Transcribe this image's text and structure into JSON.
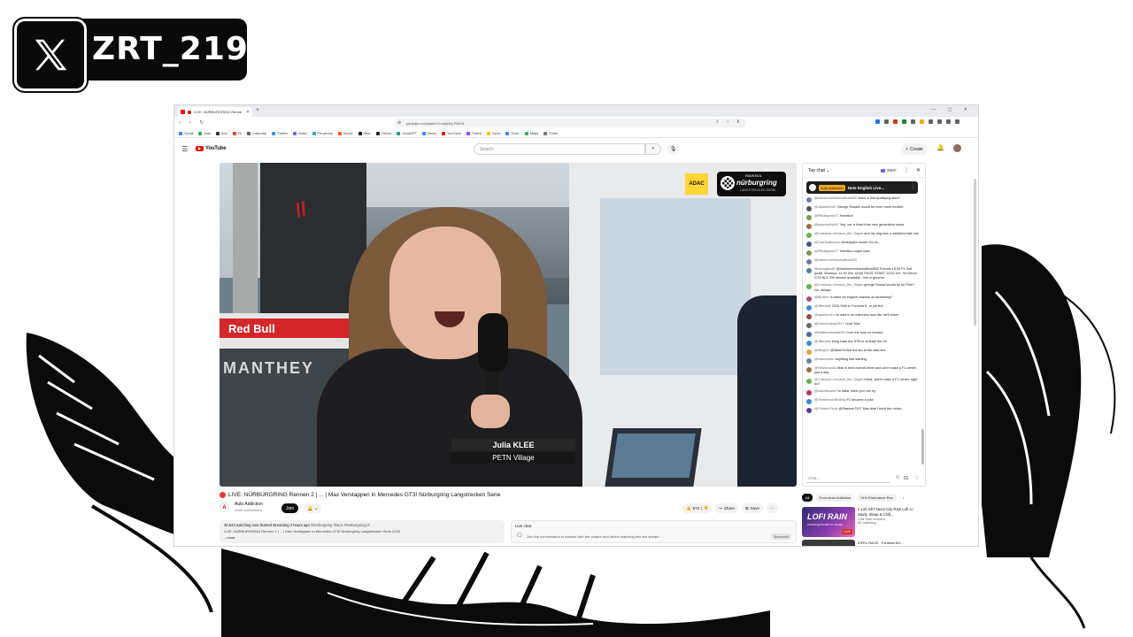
{
  "overlay": {
    "platform_icon": "x-logo-icon",
    "handle": "ZRT_219"
  },
  "browser": {
    "tab_title": "LIVE: NÜRBURGRING Renne",
    "url": "youtube.com/watch?v=mj4Hy-FiNCA",
    "bookmarks": [
      "Gmail",
      "Mail",
      "Ads",
      "Fit",
      "Calendar",
      "Twitter",
      "Anda",
      "Perplexity",
      "Music",
      "Nike",
      "Github",
      "ChatGPT",
      "News",
      "YouTube",
      "Twitch",
      "Drive",
      "Docs",
      "Maps",
      "Other",
      "Crypto",
      "Alle"
    ]
  },
  "youtube": {
    "logo_text": "YouTube",
    "search_placeholder": "Search",
    "create_label": "Create",
    "video": {
      "lower_third_name": "Julia KLEE",
      "lower_third_sub": "PETN Village",
      "adac": "ADAC",
      "nring_top": "RAVENOL",
      "nring_mid": "nürburgring",
      "nring_bot": "LANGSTRECKEN-SERIE"
    },
    "title": "LIVE: NÜRBURGRING Rennen 2 | ... | Max Verstappen in Mercedes GT3! Nürburgring Langstrecken Serie",
    "channel": "Auto Addiction",
    "subscribers": "166K subscribers",
    "join_label": "Join",
    "likes": "572",
    "share_label": "Share",
    "save_label": "Save",
    "desc_stats": "30,543 watching now  Started streaming 2 hours ago",
    "desc_tags": "#Nürburgring #NLS #NurburgringLS",
    "desc_line2": "LIVE: NÜRBURGRING Rennen 2 | ... | Max Verstappen in Mercedes GT3! Nürburgring Langstrecken Serie 2025",
    "desc_more": "...more",
    "livebox_heading": "Live chat",
    "livebox_msg": "Join the conversation to interact with the creator and others watching this live stream",
    "livebox_tag": "Sponsored"
  },
  "chat": {
    "header": "Top chat",
    "viewers": "35KF",
    "pinned_name": "Auto Addiction",
    "pinned_text": "Note English Live...",
    "messages": [
      {
        "author": "@hansrennerbackofficial392",
        "text": "when is first qualifying start?",
        "color": "#6d7fa8"
      },
      {
        "author": "@JackieDriver",
        "text": "George Russell would be even more excited",
        "color": "#555"
      },
      {
        "author": "@Pitfullspeed77",
        "text": "Hamilton",
        "color": "#7a9a5a"
      },
      {
        "author": "@sopersdrive87",
        "text": "Yep, car is fixed from new generation races",
        "color": "#9c6c4a"
      },
      {
        "author": "@Crashout-Johnson_the_Slayer",
        "text": "and my dog won a weekend last one",
        "color": "#6ab04c"
      },
      {
        "author": "@CarHuntermon",
        "text": "Verstappen mode! Go on...",
        "color": "#4a5a8a"
      },
      {
        "author": "@Pitfullspeed77",
        "text": "Hamilton super lead",
        "color": "#7a9a5a"
      },
      {
        "author": "@hansrennerbackofficial392",
        "text": "",
        "color": "#6d7fa8"
      },
      {
        "author": "@racingfan82",
        "text": "@hansrennerbackofficial392 Friends 18:30 F1 2nd qualif. Warmup: 11:40 Uhr. Uhr(l) RACE START 12:00 Uhr. Ha Demo. GT3 NLS 20h stream available - link in general",
        "color": "#5a7a9a"
      },
      {
        "author": "@Crashout-Johnson_the_Slayer",
        "text": "george Russel would try for Pole? No, always",
        "color": "#6ab04c"
      },
      {
        "author": "@Bluefire",
        "text": "Is there an english channel on streaming?",
        "color": "#9a5a7a"
      },
      {
        "author": "@JBenes6",
        "text": "2026 Shift to Formula E, or perfect",
        "color": "#3a8ad6"
      },
      {
        "author": "@sparklez91",
        "text": "He said in an interview race like he'll return",
        "color": "#9c4a4a"
      },
      {
        "author": "@Greenmama7917",
        "text": "I love Max",
        "color": "#6a6a6a"
      },
      {
        "author": "@Mattbreamcase99",
        "text": "I love the look on mclaud",
        "color": "#4a6a9a"
      },
      {
        "author": "@JBenes6",
        "text": "bring back the STB or at least the V8",
        "color": "#3a8ad6"
      },
      {
        "author": "@Wegner",
        "text": "@MadeToSee the kid at the start line",
        "color": "#d9a641"
      },
      {
        "author": "@mansonfan",
        "text": "anything fast starting",
        "color": "#6d7fa8"
      },
      {
        "author": "@Hesbeconds",
        "text": "Max is best overall driver and can't make a F1 center just a day",
        "color": "#9c6c4a"
      },
      {
        "author": "@Crashout-Johnson_the_Slayer",
        "text": "Hond, didn't make a F1 center, right do?",
        "color": "#6ab04c"
      },
      {
        "author": "@vaichlesobb",
        "text": "I'm Italia, babe you vee try",
        "color": "#b03a6a"
      },
      {
        "author": "@TheBernardKnifing",
        "text": "F1 become a joke",
        "color": "#3a8ad6"
      },
      {
        "author": "@Christo-Finds",
        "text": "@Stashon7007 Max didn't build the motor...",
        "color": "#5a3a9a"
      }
    ],
    "input_placeholder": "Chat..."
  },
  "related": {
    "chips": [
      "All",
      "From Auto Addiction",
      "VLN Endurance Rac"
    ],
    "video1_thumb_text": "LOFI RAIN",
    "video1_thumb_sub": "relaxing beats to study",
    "video1_live": "LIVE",
    "video1_title": "Lofi 24/7 Neon City Rain Lofi 🎶 Study, Sleep & Chill...",
    "video1_channel": "Chill Rain Ambient",
    "video1_watching": "6K watching",
    "video2_title": "EIFEL RACE - Formula NO..."
  }
}
